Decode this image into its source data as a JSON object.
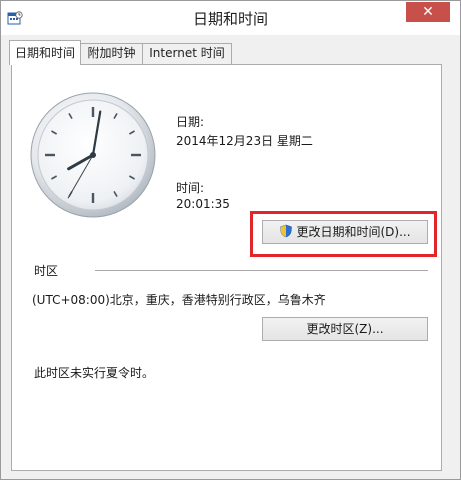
{
  "window": {
    "title": "日期和时间",
    "close_glyph": "✕"
  },
  "tabs": [
    {
      "label": "日期和时间",
      "active": true
    },
    {
      "label": "附加时钟",
      "active": false
    },
    {
      "label": "Internet 时间",
      "active": false
    }
  ],
  "clock": {
    "time": "20:01:35"
  },
  "date_section": {
    "date_label": "日期:",
    "date_value": "2014年12月23日 星期二",
    "time_label": "时间:",
    "time_value": "20:01:35"
  },
  "buttons": {
    "change_datetime": "更改日期和时间(D)...",
    "change_timezone": "更改时区(Z)..."
  },
  "timezone": {
    "section_label": "时区",
    "value": "(UTC+08:00)北京，重庆，香港特别行政区，乌鲁木齐",
    "dst_note": "此时区未实行夏令时。"
  },
  "colors": {
    "highlight": "#e0262b",
    "close_button": "#c7504a",
    "shield_blue": "#2a6fd1",
    "shield_yellow": "#f2c12e"
  },
  "icons": {
    "title": "datetime-app-icon",
    "uac": "uac-shield-icon"
  }
}
